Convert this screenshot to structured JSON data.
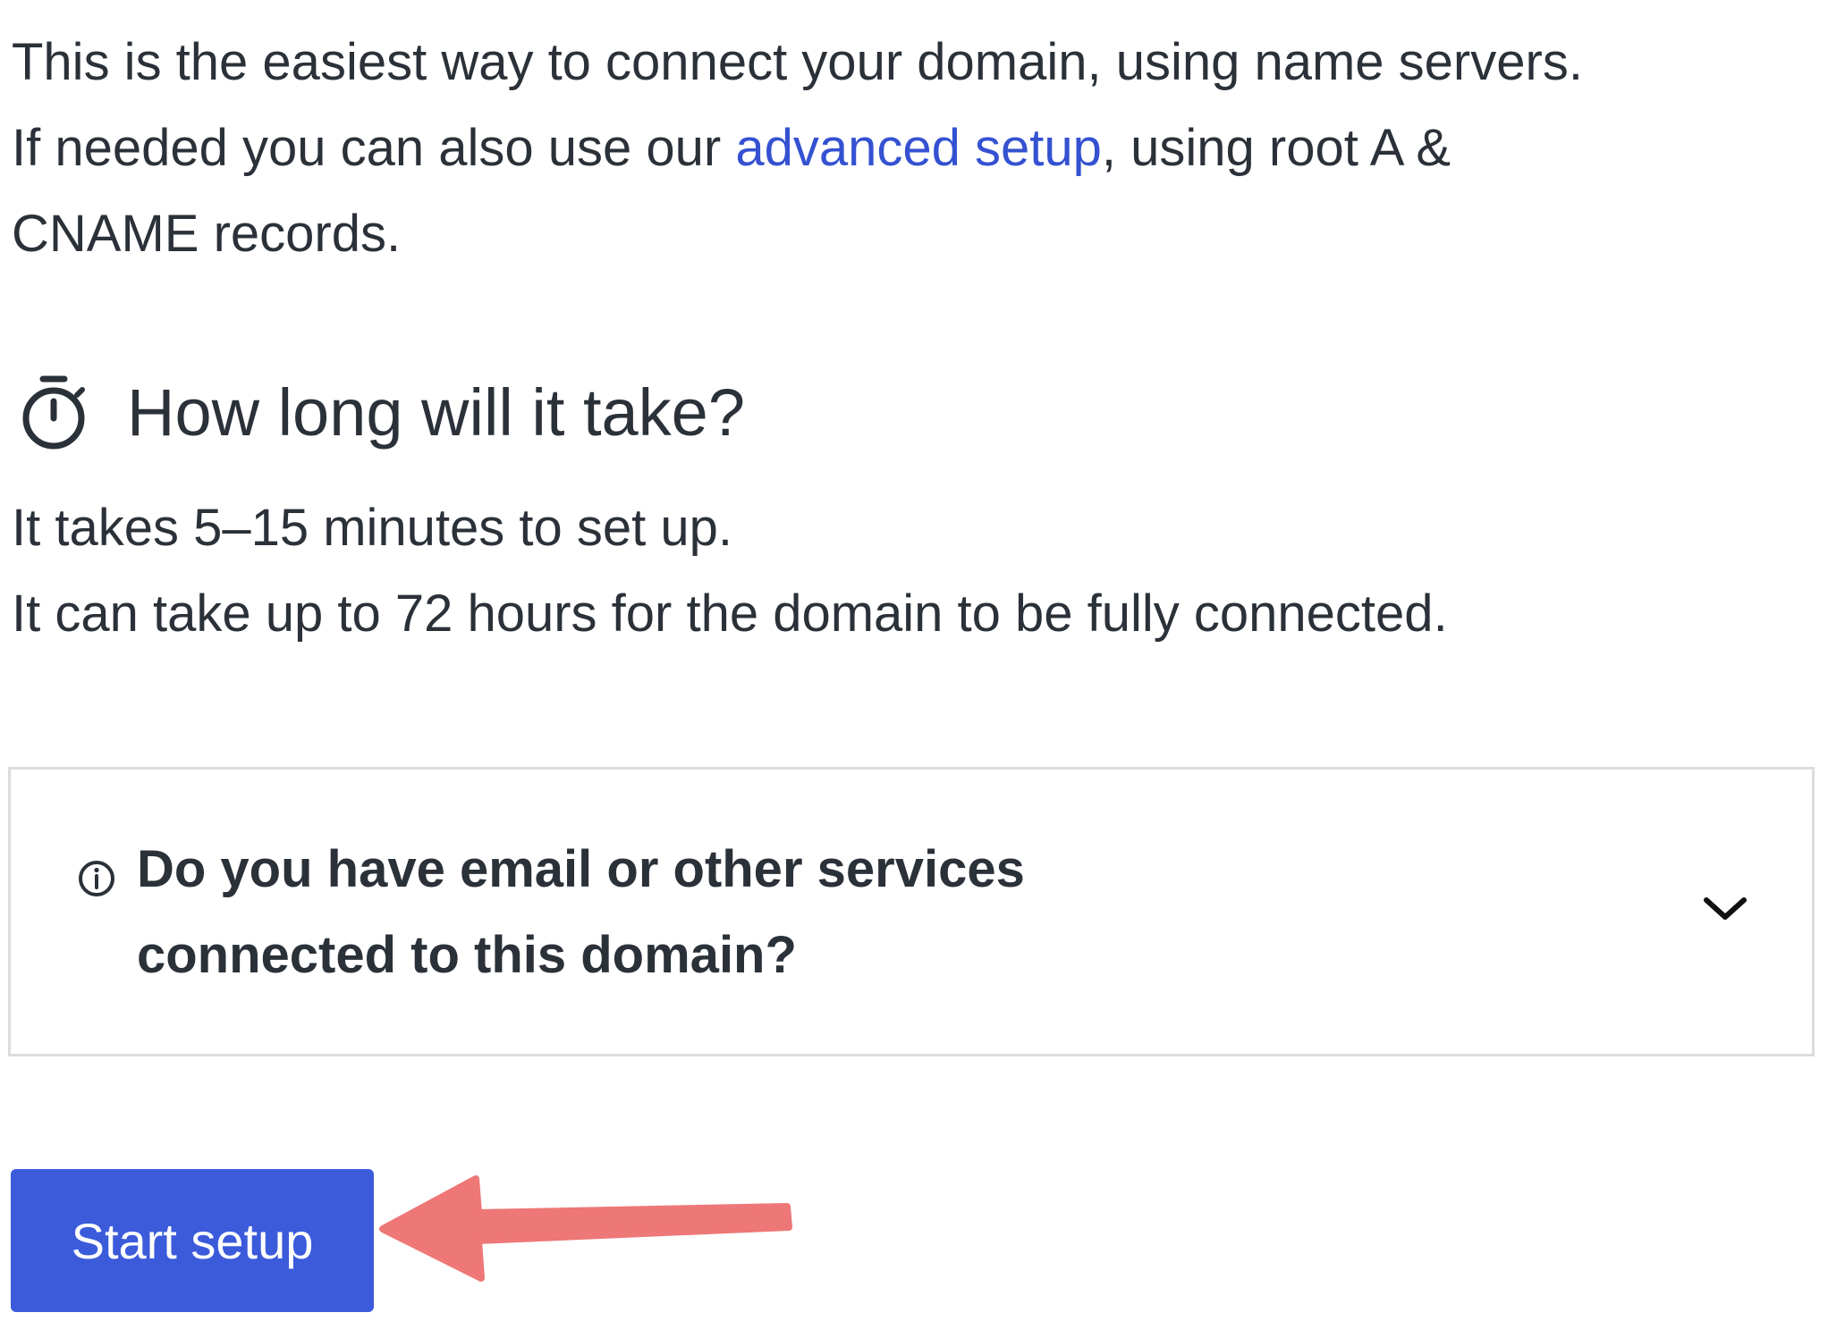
{
  "intro": {
    "line1": "This is the easiest way to connect your domain, using name servers.",
    "line2_before": "If needed you can also use our ",
    "advanced_link": "advanced setup",
    "line2_after": ", using root A &",
    "line3": "CNAME records."
  },
  "section": {
    "icon": "stopwatch-icon",
    "heading": "How long will it take?",
    "setup_time": "It takes 5–15 minutes to set up.",
    "propagation": "It can take up to 72 hours for the domain to be fully connected."
  },
  "accordion": {
    "icon": "info-icon",
    "question_line1": "Do you have email or other services",
    "question_line2": "connected to this domain?",
    "toggle_icon": "chevron-down-icon"
  },
  "actions": {
    "start_label": "Start setup"
  },
  "annotation": {
    "arrow_icon": "arrow-left-icon",
    "arrow_color": "#ee7777"
  },
  "colors": {
    "text": "#2b3139",
    "link": "#3451d1",
    "button": "#3b5bdb",
    "border": "#dcdcdc"
  }
}
